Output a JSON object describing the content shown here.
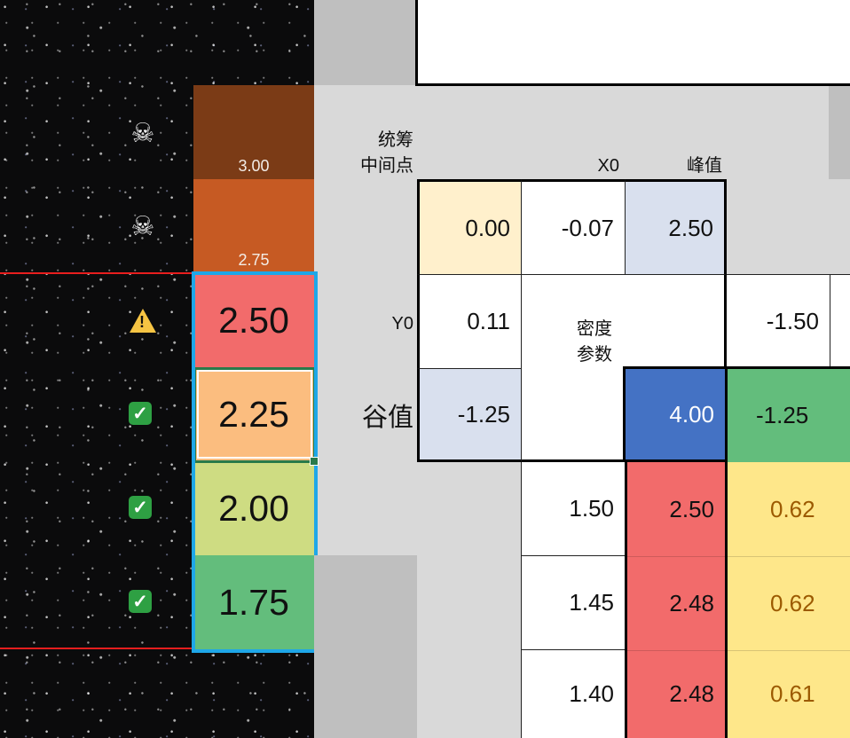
{
  "scale_cells": [
    {
      "value": "3.00",
      "color": "#7b3b16",
      "status_icon": "skull-icon"
    },
    {
      "value": "2.75",
      "color": "#c65a23",
      "status_icon": "skull-icon"
    },
    {
      "value": "2.50",
      "color": "#f26b6b",
      "status_icon": "warning-icon"
    },
    {
      "value": "2.25",
      "color": "#fbbd7f",
      "status_icon": "check-icon"
    },
    {
      "value": "2.00",
      "color": "#cedc82",
      "status_icon": "check-icon"
    },
    {
      "value": "1.75",
      "color": "#63bd7c",
      "status_icon": "check-icon"
    }
  ],
  "labels": {
    "tongchou": "统筹",
    "zhongjiandian": "中间点",
    "x0": "X0",
    "fengzhi": "峰值",
    "y0": "Y0",
    "midu": "密度",
    "canshu": "参数",
    "guzhi": "谷值"
  },
  "params": {
    "mid": "0.00",
    "x0": "-0.07",
    "peak": "2.50",
    "y0": "0.11",
    "density": "-1.50",
    "valley": "-1.25",
    "blue": "4.00",
    "green": "-1.25"
  },
  "table_rows": [
    {
      "a": "1.50",
      "b": "2.50",
      "c": "0.62"
    },
    {
      "a": "1.45",
      "b": "2.48",
      "c": "0.62"
    },
    {
      "a": "1.40",
      "b": "2.48",
      "c": "0.61"
    }
  ],
  "colors": {
    "mid_bg": "#fff0cc",
    "peak_bg": "#d9e0ee",
    "blue_bg": "#4472c4",
    "green_bg": "#63bd7c",
    "red_bg": "#f26b6b",
    "yellow_bg": "#fee78a",
    "yellow_text": "#9c5a00",
    "selection": "#1ea7e8",
    "threshold_line": "#e81e1e"
  }
}
